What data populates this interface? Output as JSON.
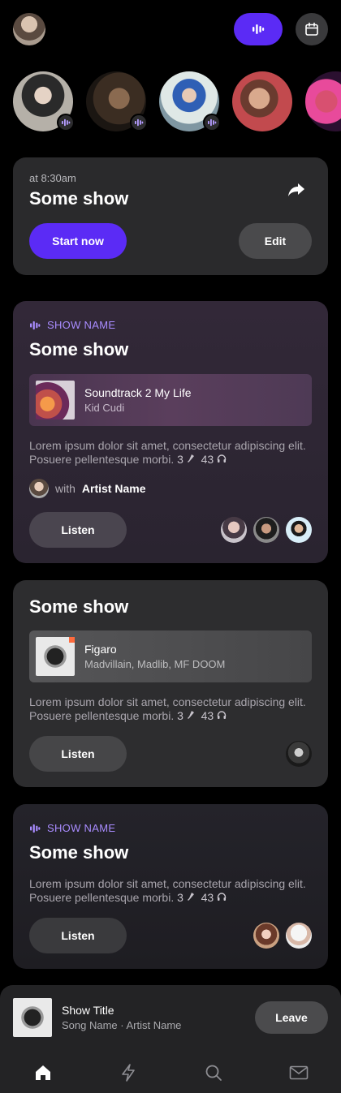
{
  "header": {
    "profile_icon": "user-avatar",
    "live_button_icon": "audio-wave-icon",
    "calendar_button_icon": "calendar-icon",
    "accent_color": "#5b2bf5"
  },
  "stories": [
    {
      "icon": "audio-wave-icon",
      "live": true
    },
    {
      "icon": "audio-wave-icon",
      "live": true
    },
    {
      "icon": "audio-wave-icon",
      "live": true
    },
    {
      "live": false
    },
    {
      "live": false
    }
  ],
  "scheduled": {
    "time": "at 8:30am",
    "title": "Some show",
    "start_label": "Start now",
    "edit_label": "Edit",
    "share_icon": "share-icon"
  },
  "shows": [
    {
      "label": "SHOW NAME",
      "title": "Some show",
      "track_title": "Soundtrack 2 My Life",
      "track_artist": "Kid Cudi",
      "description": "Lorem ipsum dolor sit amet, consectetur adipiscing elit. Posuere pellentesque morbi.",
      "mic_count": "3",
      "listener_count": "43",
      "with_prefix": "with",
      "artist_name": "Artist Name",
      "listen_label": "Listen"
    },
    {
      "title": "Some show",
      "track_title": "Figaro",
      "track_artist": "Madvillain, Madlib, MF DOOM",
      "description": "Lorem ipsum dolor sit amet, consectetur adipiscing elit. Posuere pellentesque morbi.",
      "mic_count": "3",
      "listener_count": "43",
      "listen_label": "Listen"
    },
    {
      "label": "SHOW NAME",
      "title": "Some show",
      "description": "Lorem ipsum dolor sit amet, consectetur adipiscing elit. Posuere pellentesque morbi.",
      "mic_count": "3",
      "listener_count": "43",
      "listen_label": "Listen"
    }
  ],
  "now_playing": {
    "title": "Show Title",
    "subtitle": "Song Name · Artist Name",
    "leave_label": "Leave"
  },
  "tabbar": {
    "items": [
      "home-icon",
      "lightning-icon",
      "search-icon",
      "mail-icon"
    ],
    "active": "home-icon"
  }
}
